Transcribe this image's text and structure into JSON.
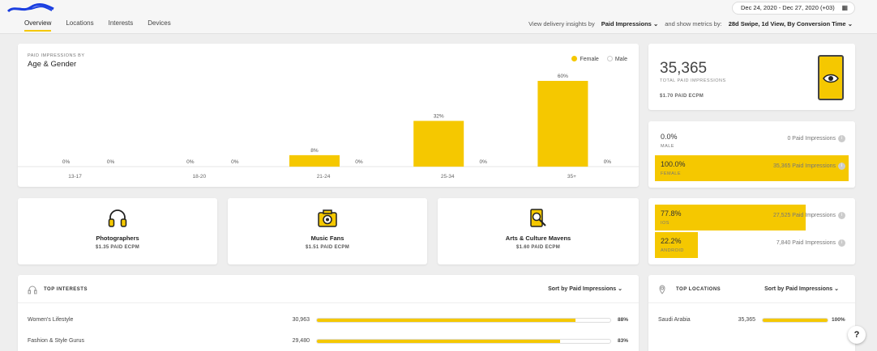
{
  "header": {
    "tabs": [
      "Overview",
      "Locations",
      "Interests",
      "Devices"
    ],
    "active_tab": 0,
    "date_range": "Dec 24, 2020 - Dec 27, 2020 (+03)",
    "delivery_label": "View delivery insights by",
    "delivery_value": "Paid Impressions",
    "metrics_label": "and show metrics by:",
    "metrics_value": "28d Swipe, 1d View, By Conversion Time"
  },
  "age_gender": {
    "subtitle": "PAID IMPRESSIONS BY",
    "title": "Age & Gender",
    "legend": {
      "female": "Female",
      "male": "Male"
    }
  },
  "chart_data": {
    "type": "bar",
    "title": "Age & Gender",
    "categories": [
      "13-17",
      "18-20",
      "21-24",
      "25-34",
      "35+"
    ],
    "series": [
      {
        "name": "Female",
        "values": [
          0,
          0,
          8,
          32,
          60
        ],
        "labels": [
          "0%",
          "0%",
          "8%",
          "32%",
          "60%"
        ]
      },
      {
        "name": "Male",
        "values": [
          0,
          0,
          0,
          0,
          0
        ],
        "labels": [
          "0%",
          "0%",
          "0%",
          "0%",
          "0%"
        ]
      }
    ],
    "ylim": [
      0,
      60
    ],
    "colors": {
      "female": "#f5c800",
      "male": "#dddddd"
    },
    "legend_position": "top-right"
  },
  "totals": {
    "value": "35,365",
    "label": "TOTAL PAID IMPRESSIONS",
    "ecpm": "$1.70 PAID ECPM"
  },
  "gender": [
    {
      "pct": "0.0%",
      "name": "MALE",
      "count": "0 Paid Impressions",
      "share": 0
    },
    {
      "pct": "100.0%",
      "name": "FEMALE",
      "count": "35,365 Paid Impressions",
      "share": 100
    }
  ],
  "devices": [
    {
      "pct": "77.8%",
      "name": "IOS",
      "count": "27,525 Paid Impressions",
      "share": 77.8
    },
    {
      "pct": "22.2%",
      "name": "ANDROID",
      "count": "7,840 Paid Impressions",
      "share": 22.2
    }
  ],
  "categories": [
    {
      "name": "Photographers",
      "ecpm": "$1.35 PAID ECPM",
      "icon": "headphones-icon"
    },
    {
      "name": "Music Fans",
      "ecpm": "$1.51 PAID ECPM",
      "icon": "camera-icon"
    },
    {
      "name": "Arts & Culture Mavens",
      "ecpm": "$1.60 PAID ECPM",
      "icon": "palette-icon"
    }
  ],
  "interests": {
    "title": "TOP INTERESTS",
    "sort": "Sort by Paid Impressions",
    "rows": [
      {
        "label": "Women's Lifestyle",
        "value": "30,963",
        "pct": "88%",
        "share": 88
      },
      {
        "label": "Fashion & Style Gurus",
        "value": "29,480",
        "pct": "83%",
        "share": 83
      }
    ]
  },
  "locations": {
    "title": "TOP LOCATIONS",
    "sort": "Sort by Paid Impressions",
    "rows": [
      {
        "label": "Saudi Arabia",
        "value": "35,365",
        "pct": "100%",
        "share": 100
      }
    ]
  },
  "help": "?"
}
